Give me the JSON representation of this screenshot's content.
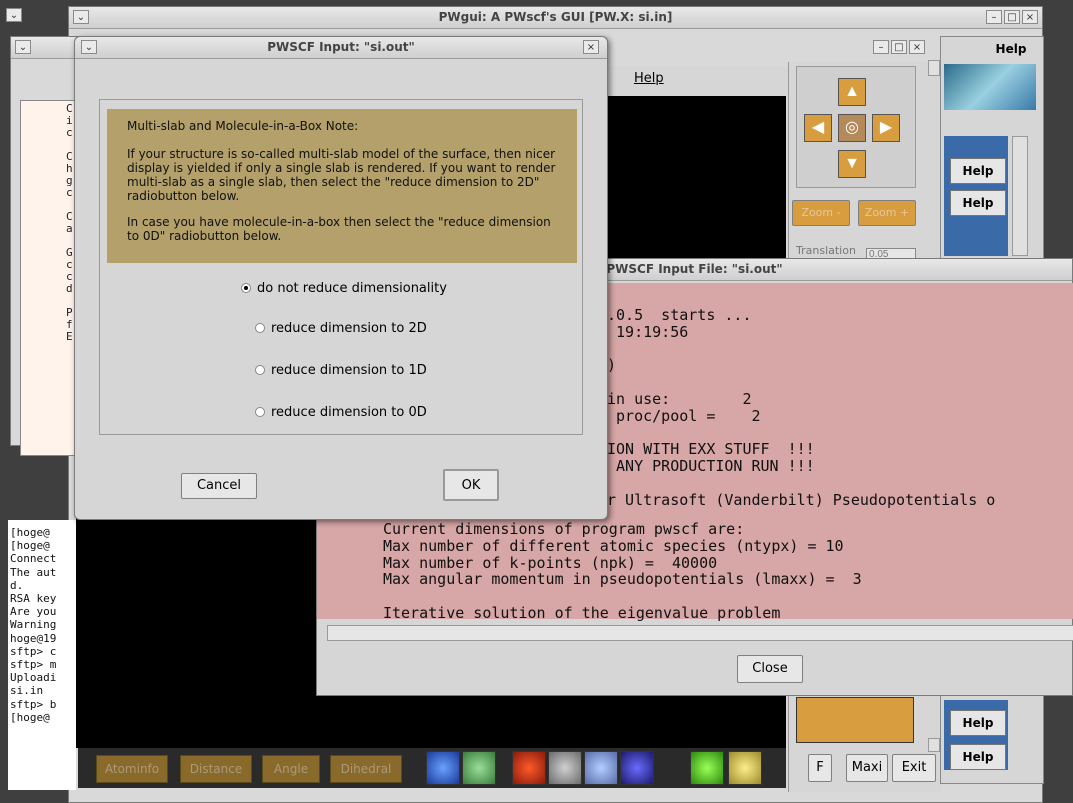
{
  "main_window": {
    "title": "PWgui: A PWscf's GUI  [PW.X: si.in]"
  },
  "dialog": {
    "title": "PWSCF Input: \"si.out\"",
    "note_title": "Multi-slab and Molecule-in-a-Box Note:",
    "note_p1": "If your structure is so-called multi-slab model of the surface, then nicer display is yielded if only a single slab is rendered. If you want to render multi-slab as a single slab, then select the \"reduce dimension to 2D\" radiobutton below.",
    "note_p2": "In case you have molecule-in-a-box then select the \"reduce dimension to 0D\" radiobutton below.",
    "options": [
      "do not reduce dimensionality",
      "reduce dimension to 2D",
      "reduce dimension to 1D",
      "reduce dimension to 0D"
    ],
    "selected_index": 0,
    "cancel": "Cancel",
    "ok": "OK"
  },
  "viewer": {
    "help_menu": "Help",
    "zoom_minus": "Zoom -",
    "zoom_plus": "Zoom +",
    "translation": "Translation",
    "translation_value": "0.05",
    "bottom_buttons": [
      "Atominfo",
      "Distance",
      "Angle",
      "Dihedral"
    ],
    "f_btn": "F",
    "maxi_btn": "Maxi",
    "exit_btn": "Exit"
  },
  "file_window": {
    "title": "PWSCF Input File: \"si.out\"",
    "lines": [
      ".0.5  starts ...",
      " 19:19:56",
      "",
      ")",
      "",
      "in use:        2",
      " proc/pool =    2",
      "",
      "ION WITH EXX STUFF  !!!",
      " ANY PRODUCTION RUN !!!",
      "",
      "r Ultrasoft (Vanderbilt) Pseudopotentials o"
    ],
    "lines_full": [
      "Current dimensions of program pwscf are:",
      "Max number of different atomic species (ntypx) = 10",
      "Max number of k-points (npk) =  40000",
      "Max angular momentum in pseudopotentials (lmaxx) =  3",
      "",
      "Iterative solution of the eigenvalue problem"
    ],
    "close": "Close"
  },
  "right_panel": {
    "help_labels": [
      "Help",
      "Help",
      "Help",
      "Help",
      "Help",
      "Help"
    ]
  },
  "terminal": {
    "lines": [
      "[hoge@",
      "[hoge@",
      "Connect",
      "The aut",
      "d.",
      "RSA key",
      "Are you",
      "Warning",
      "hoge@19",
      "sftp> c",
      "sftp> m",
      "Uploadi",
      "si.in",
      "sftp> b",
      "[hoge@"
    ]
  },
  "left_panel": {
    "chars": [
      "C",
      "i",
      "c",
      "",
      "C",
      "h",
      "g",
      "c",
      "",
      "C",
      "a",
      "",
      "G",
      "c",
      "c",
      "d",
      "",
      "P",
      "f",
      "E"
    ]
  },
  "colors": {
    "note_bg": "#b3a06a",
    "file_bg": "#d7a6a6",
    "viewer_bg": "#000000",
    "desktop": "#3f3f3f"
  }
}
